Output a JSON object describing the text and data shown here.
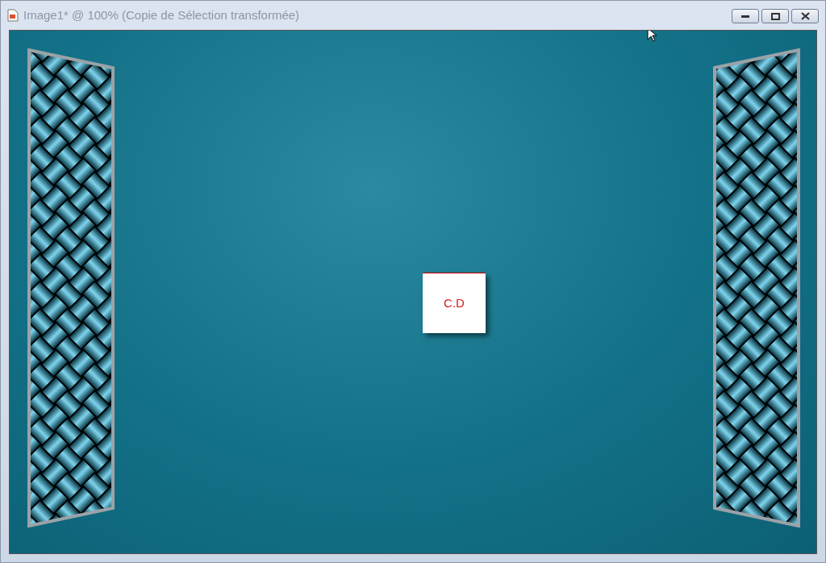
{
  "window": {
    "title": "Image1* @ 100% (Copie de Sélection transformée)"
  },
  "canvas": {
    "stamp_text": "C.D"
  }
}
